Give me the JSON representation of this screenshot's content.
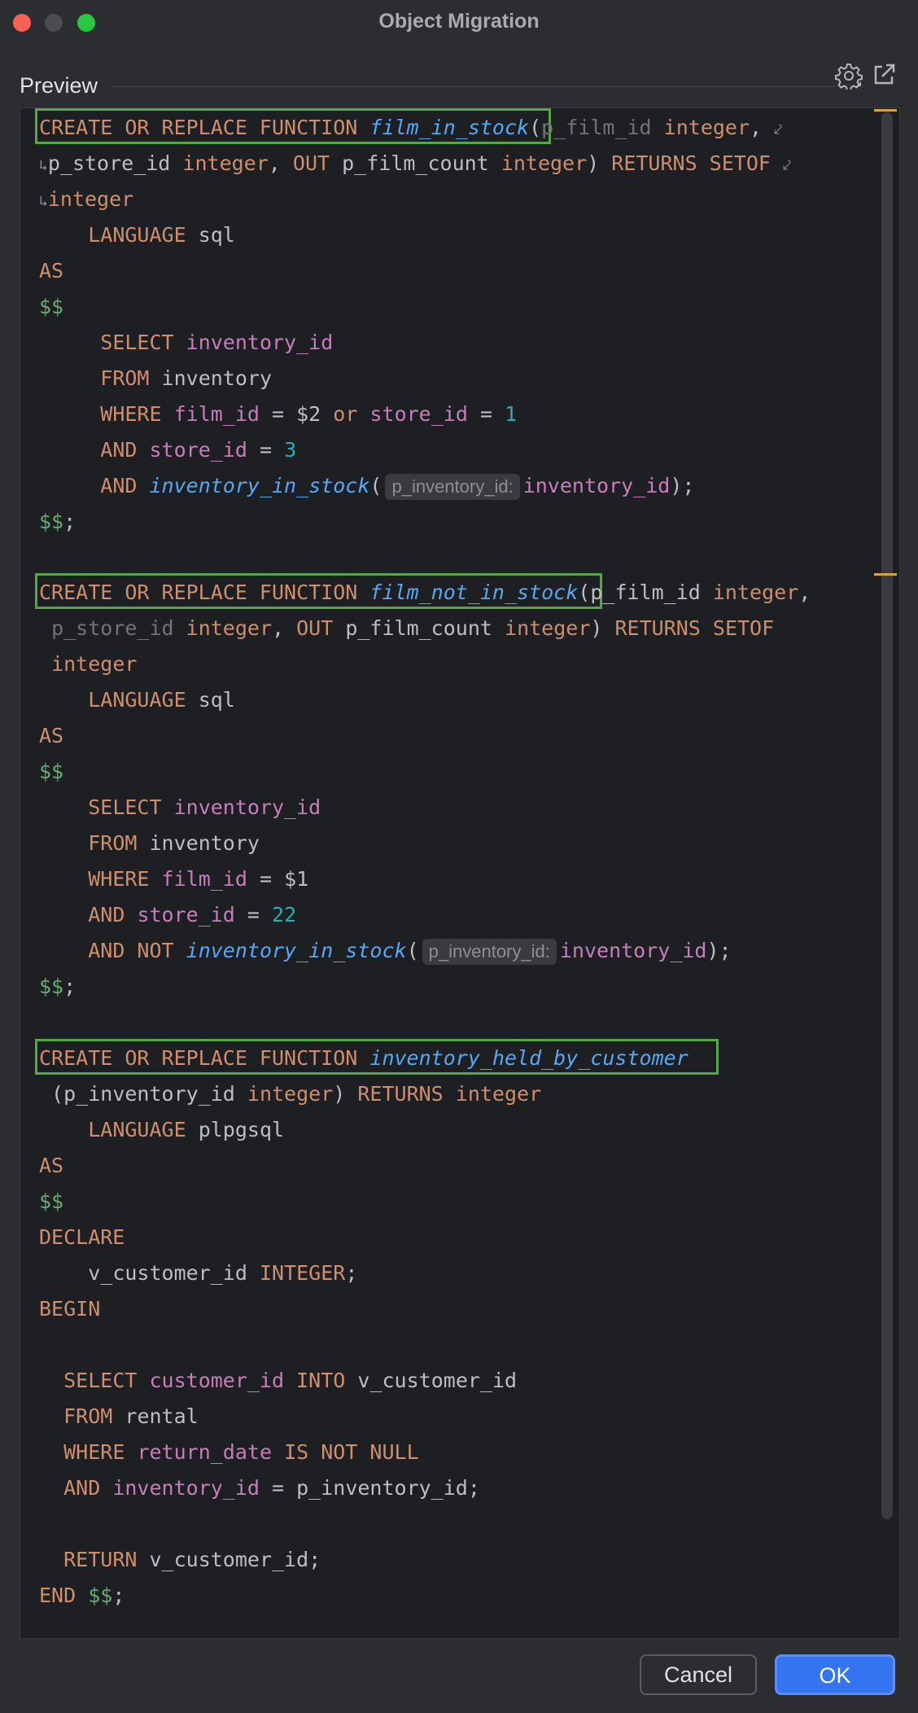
{
  "window": {
    "title": "Object Migration"
  },
  "preview": {
    "label": "Preview",
    "settings_icon": "gear-icon",
    "open_icon": "external-link-icon"
  },
  "colors": {
    "highlight_border": "#57a64a",
    "accent": "#3574f0",
    "keyword": "#cf8e6d",
    "function": "#56a8f5",
    "column": "#c77dbb",
    "number": "#2aacb8",
    "dollar": "#6aab73"
  },
  "code": {
    "f1": {
      "create": "CREATE OR REPLACE FUNCTION",
      "name": "film_in_stock",
      "p1": "p_film_id",
      "p2": "p_store_id",
      "out": "OUT",
      "p3": "p_film_count",
      "integer": "integer",
      "returns": "RETURNS SETOF",
      "language": "LANGUAGE",
      "lang": "sql",
      "as": "AS",
      "dollar": "$$",
      "select": "SELECT",
      "inventory_id": "inventory_id",
      "from": "FROM",
      "table": "inventory",
      "where": "WHERE",
      "film_id": "film_id",
      "eq_film": "= $2",
      "or": "or",
      "store_id": "store_id",
      "eq": "=",
      "v1": "1",
      "and": "AND",
      "v3": "3",
      "call": "inventory_in_stock",
      "hint": "p_inventory_id:",
      "end": "$$"
    },
    "f2": {
      "create": "CREATE OR REPLACE FUNCTION",
      "name": "film_not_in_stock",
      "p1": "p_film_id",
      "p2": "p_store_id",
      "out": "OUT",
      "p3": "p_film_count",
      "integer": "integer",
      "returns": "RETURNS SETOF",
      "language": "LANGUAGE",
      "lang": "sql",
      "as": "AS",
      "dollar": "$$",
      "select": "SELECT",
      "inventory_id": "inventory_id",
      "from": "FROM",
      "table": "inventory",
      "where": "WHERE",
      "film_id": "film_id",
      "eq_film": "= $1",
      "and": "AND",
      "store_id": "store_id",
      "eq": "=",
      "v22": "22",
      "and_not": "AND NOT",
      "call": "inventory_in_stock",
      "hint": "p_inventory_id:",
      "end": "$$"
    },
    "f3": {
      "create": "CREATE OR REPLACE FUNCTION",
      "name": "inventory_held_by_customer",
      "param": "p_inventory_id",
      "integer": "integer",
      "returns": "RETURNS",
      "language": "LANGUAGE",
      "lang": "plpgsql",
      "as": "AS",
      "dollar": "$$",
      "declare": "DECLARE",
      "var": "v_customer_id",
      "type": "INTEGER",
      "begin": "BEGIN",
      "select": "SELECT",
      "customer_id": "customer_id",
      "into": "INTO",
      "from": "FROM",
      "table": "rental",
      "where": "WHERE",
      "return_date": "return_date",
      "is_not_null": "IS NOT NULL",
      "and": "AND",
      "inventory_id": "inventory_id",
      "eq_param": "= p_inventory_id;",
      "return": "RETURN",
      "end": "END"
    }
  },
  "buttons": {
    "cancel": "Cancel",
    "ok": "OK"
  }
}
